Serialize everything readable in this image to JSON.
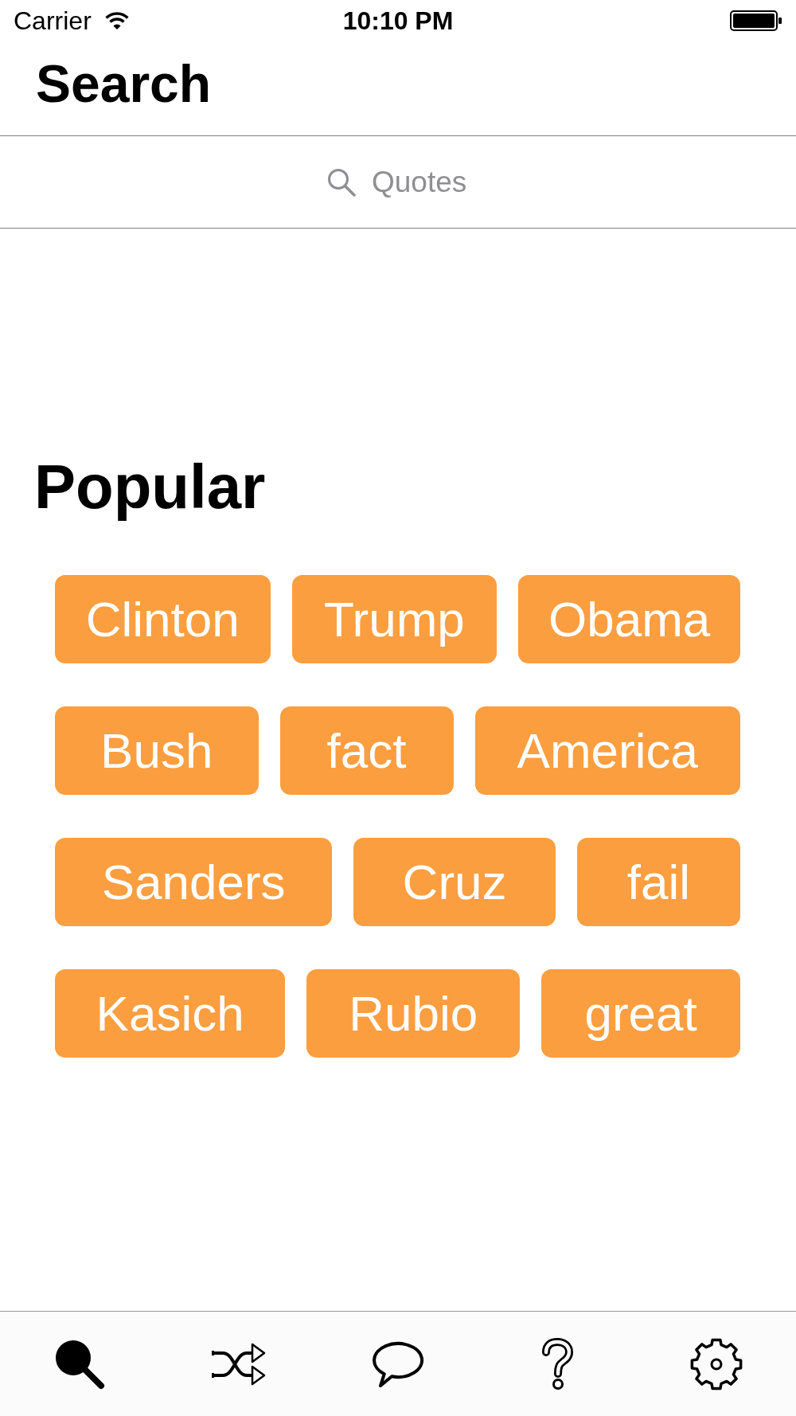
{
  "status_bar": {
    "carrier": "Carrier",
    "time": "10:10 PM"
  },
  "navigation": {
    "title": "Search"
  },
  "search": {
    "placeholder": "Quotes"
  },
  "popular": {
    "heading": "Popular",
    "rows": [
      [
        "Clinton",
        "Trump",
        "Obama"
      ],
      [
        "Bush",
        "fact",
        "America"
      ],
      [
        "Sanders",
        "Cruz",
        "fail"
      ],
      [
        "Kasich",
        "Rubio",
        "great"
      ]
    ]
  },
  "tab_bar": {
    "tabs": [
      {
        "kind": "search",
        "selected": true
      },
      {
        "kind": "shuffle",
        "selected": false
      },
      {
        "kind": "chat",
        "selected": false
      },
      {
        "kind": "help",
        "selected": false
      },
      {
        "kind": "settings",
        "selected": false
      }
    ]
  }
}
